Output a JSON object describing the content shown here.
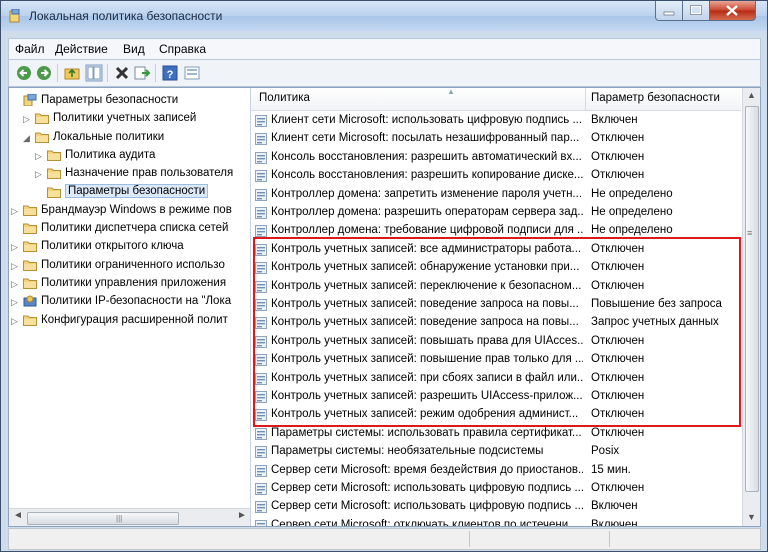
{
  "window": {
    "title": "Локальная политика безопасности"
  },
  "menu": [
    "Файл",
    "Действие",
    "Вид",
    "Справка"
  ],
  "toolbar": {
    "buttons": [
      "back-icon",
      "forward-icon",
      "up-folder-icon",
      "show-tree-icon",
      "delete-icon",
      "export-icon",
      "help-icon",
      "properties-icon"
    ]
  },
  "tree": {
    "items": [
      {
        "label": "Параметры безопасности",
        "level": 0,
        "arrow": "",
        "icon": "security-settings-icon"
      },
      {
        "label": "Политики учетных записей",
        "level": 1,
        "arrow": "▷",
        "icon": "folder-icon"
      },
      {
        "label": "Локальные политики",
        "level": 1,
        "arrow": "◢",
        "icon": "folder-icon"
      },
      {
        "label": "Политика аудита",
        "level": 2,
        "arrow": "▷",
        "icon": "folder-icon"
      },
      {
        "label": "Назначение прав пользователя",
        "level": 2,
        "arrow": "▷",
        "icon": "folder-icon"
      },
      {
        "label": "Параметры безопасности",
        "level": 2,
        "arrow": "",
        "icon": "folder-icon",
        "selected": true
      },
      {
        "label": "Брандмауэр Windows в режиме пов",
        "level": 0,
        "arrow": "▷",
        "icon": "folder-icon"
      },
      {
        "label": "Политики диспетчера списка сетей",
        "level": 0,
        "arrow": "",
        "icon": "folder-icon"
      },
      {
        "label": "Политики открытого ключа",
        "level": 0,
        "arrow": "▷",
        "icon": "folder-icon"
      },
      {
        "label": "Политики ограниченного использо",
        "level": 0,
        "arrow": "▷",
        "icon": "folder-icon"
      },
      {
        "label": "Политики управления приложения",
        "level": 0,
        "arrow": "▷",
        "icon": "folder-icon"
      },
      {
        "label": "Политики IP-безопасности на \"Лока",
        "level": 0,
        "arrow": "▷",
        "icon": "ipsec-icon"
      },
      {
        "label": "Конфигурация расширенной полит",
        "level": 0,
        "arrow": "▷",
        "icon": "folder-icon"
      }
    ]
  },
  "list": {
    "columns": [
      "Политика",
      "Параметр безопасности"
    ],
    "rows": [
      {
        "policy": "Клиент сети Microsoft: использовать цифровую подпись ...",
        "value": "Включен"
      },
      {
        "policy": "Клиент сети Microsoft: посылать незашифрованный пар...",
        "value": "Отключен"
      },
      {
        "policy": "Консоль восстановления: разрешить автоматический вх...",
        "value": "Отключен"
      },
      {
        "policy": "Консоль восстановления: разрешить копирование диске...",
        "value": "Отключен"
      },
      {
        "policy": "Контроллер домена: запретить изменение пароля учетн...",
        "value": "Не определено"
      },
      {
        "policy": "Контроллер домена: разрешить операторам сервера зад...",
        "value": "Не определено"
      },
      {
        "policy": "Контроллер домена: требование цифровой подписи для ...",
        "value": "Не определено"
      },
      {
        "policy": "Контроль учетных записей: все администраторы работа...",
        "value": "Отключен"
      },
      {
        "policy": "Контроль учетных записей: обнаружение установки при...",
        "value": "Отключен"
      },
      {
        "policy": "Контроль учетных записей: переключение к безопасном...",
        "value": "Отключен"
      },
      {
        "policy": "Контроль учетных записей: поведение запроса на повы...",
        "value": "Повышение без запроса"
      },
      {
        "policy": "Контроль учетных записей: поведение запроса на повы...",
        "value": "Запрос учетных данных"
      },
      {
        "policy": "Контроль учетных записей: повышать права для UIAcces...",
        "value": "Отключен"
      },
      {
        "policy": "Контроль учетных записей: повышение прав только для ...",
        "value": "Отключен"
      },
      {
        "policy": "Контроль учетных записей: при сбоях записи в файл или...",
        "value": "Отключен"
      },
      {
        "policy": "Контроль учетных записей: разрешить UIAccess-прилож...",
        "value": "Отключен"
      },
      {
        "policy": "Контроль учетных записей: режим одобрения админист...",
        "value": "Отключен"
      },
      {
        "policy": "Параметры системы: использовать правила сертификат...",
        "value": "Отключен"
      },
      {
        "policy": "Параметры системы: необязательные подсистемы",
        "value": "Posix"
      },
      {
        "policy": "Сервер сети Microsoft: время бездействия до приостанов...",
        "value": "15 мин."
      },
      {
        "policy": "Сервер сети Microsoft: использовать цифровую подпись ...",
        "value": "Отключен"
      },
      {
        "policy": "Сервер сети Microsoft: использовать цифровую подпись ...",
        "value": "Включен"
      },
      {
        "policy": "Сервер сети Microsoft: отключать клиентов по истечени...",
        "value": "Включен"
      }
    ]
  },
  "colors": {
    "highlight_box": "#e0181c",
    "window_chrome": "#b9d1ee"
  }
}
